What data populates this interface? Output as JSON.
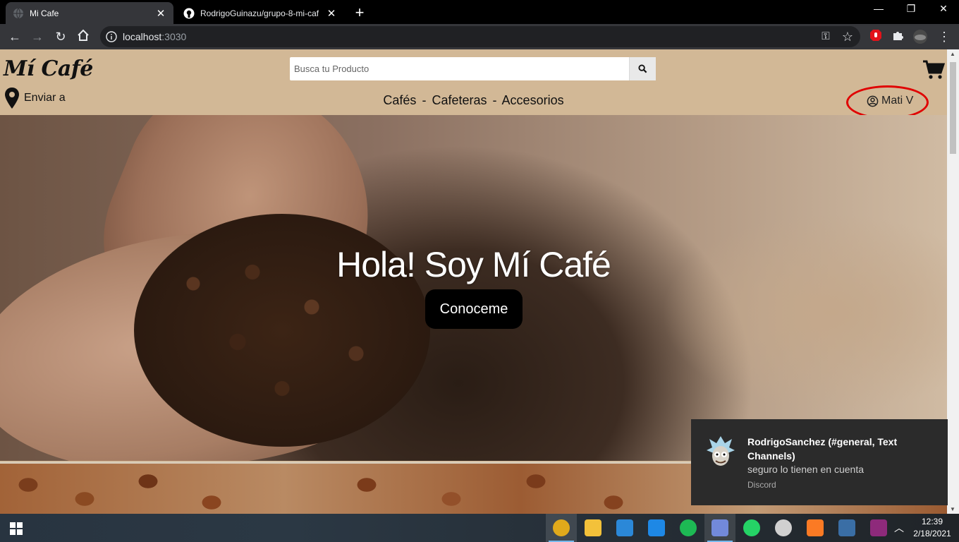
{
  "browser": {
    "tabs": [
      {
        "title": "Mi Cafe",
        "active": true
      },
      {
        "title": "RodrigoGuinazu/grupo-8-mi-caf",
        "active": false
      }
    ],
    "url_host": "localhost",
    "url_port": ":3030"
  },
  "site": {
    "logo": "Mí Café",
    "search_placeholder": "Busca tu Producto",
    "location_label": "Enviar a",
    "nav": {
      "item1": "Cafés",
      "sep": "-",
      "item2": "Cafeteras",
      "item3": "Accesorios"
    },
    "user_name": "Mati V",
    "hero_title": "Hola! Soy Mí Café",
    "hero_button": "Conoceme"
  },
  "notification": {
    "title": "RodrigoSanchez (#general, Text Channels)",
    "message": "seguro lo tienen en cuenta",
    "app": "Discord"
  },
  "taskbar": {
    "apps": [
      {
        "name": "chrome",
        "color": "#e0a91b",
        "active": true
      },
      {
        "name": "file-explorer",
        "color": "#f3c13a",
        "active": false
      },
      {
        "name": "mail",
        "color": "#2b88d8",
        "active": false
      },
      {
        "name": "vscode",
        "color": "#1e88e5",
        "active": false
      },
      {
        "name": "spotify",
        "color": "#1db954",
        "active": false
      },
      {
        "name": "discord",
        "color": "#7289da",
        "active": true
      },
      {
        "name": "whatsapp",
        "color": "#25d366",
        "active": false
      },
      {
        "name": "obs",
        "color": "#d0d0d0",
        "active": false
      },
      {
        "name": "xampp",
        "color": "#fb7a24",
        "active": false
      },
      {
        "name": "mysql-workbench",
        "color": "#3a6ea5",
        "active": false
      },
      {
        "name": "winrar",
        "color": "#8e2a7b",
        "active": false
      }
    ],
    "time": "12:39",
    "date": "2/18/2021"
  },
  "colors": {
    "header_bg": "#d2b896",
    "highlight_circle": "#e00000"
  }
}
